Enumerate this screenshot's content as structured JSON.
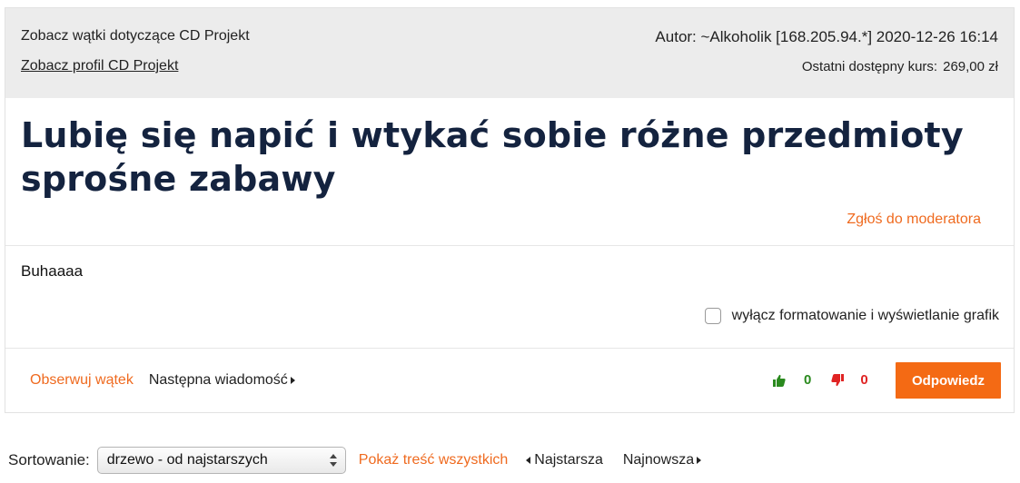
{
  "header": {
    "threads_link": "Zobacz wątki dotyczące CD Projekt",
    "profile_link": "Zobacz profil CD Projekt",
    "author_line": "Autor: ~Alkoholik [168.205.94.*] 2020-12-26 16:14",
    "price_label": "Ostatni dostępny kurs:",
    "price_value": "269,00 zł"
  },
  "post": {
    "title": "Lubię się napić i wtykać sobie różne przedmioty sprośne zabawy",
    "report_link": "Zgłoś do moderatora",
    "body": "Buhaaaa",
    "format_toggle_label": "wyłącz formatowanie i wyświetlanie grafik",
    "format_toggle_checked": false
  },
  "footer": {
    "watch_link": "Obserwuj wątek",
    "next_message": "Następna wiadomość",
    "votes_up": "0",
    "votes_down": "0",
    "reply_button": "Odpowiedz"
  },
  "sort_bar": {
    "label": "Sortowanie:",
    "selected": "drzewo - od najstarszych",
    "show_all": "Pokaż treść wszystkich",
    "oldest": "Najstarsza",
    "newest": "Najnowsza"
  },
  "colors": {
    "accent": "#ef6a1f",
    "button": "#f46a14",
    "title": "#14233f",
    "header_bg": "#ececec",
    "vote_up": "#2a8a1e",
    "vote_down": "#e02323"
  },
  "icons": {
    "vote_up": "thumb-up-icon",
    "vote_down": "thumb-down-icon",
    "next": "caret-right-icon",
    "prev": "caret-left-icon"
  }
}
